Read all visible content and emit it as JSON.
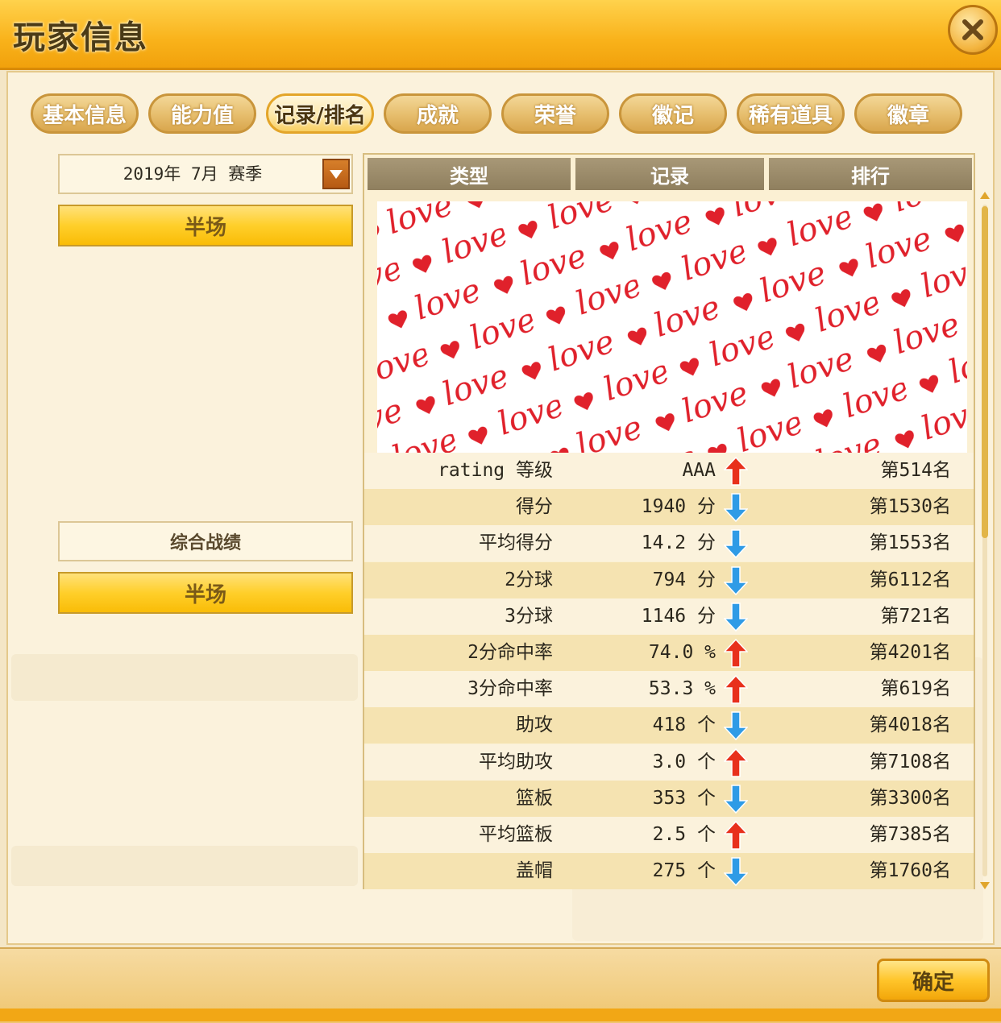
{
  "window": {
    "title": "玩家信息"
  },
  "tabs": [
    {
      "label": "基本信息",
      "active": false
    },
    {
      "label": "能力值",
      "active": false
    },
    {
      "label": "记录/排名",
      "active": true
    },
    {
      "label": "成就",
      "active": false
    },
    {
      "label": "荣誉",
      "active": false
    },
    {
      "label": "徽记",
      "active": false
    },
    {
      "label": "稀有道具",
      "active": false
    },
    {
      "label": "徽章",
      "active": false
    }
  ],
  "left_panel": {
    "season": "2019年 7月 赛季",
    "mode_top": "半场",
    "overall_label": "综合战绩",
    "mode_bottom": "半场"
  },
  "table": {
    "headers": [
      "类型",
      "记录",
      "排行"
    ],
    "banner_text": "love",
    "rows": [
      {
        "type": "rating 等级",
        "value": "AAA",
        "trend": "up",
        "rank": "第514名"
      },
      {
        "type": "得分",
        "value": "1940 分",
        "trend": "down",
        "rank": "第1530名"
      },
      {
        "type": "平均得分",
        "value": "14.2 分",
        "trend": "down",
        "rank": "第1553名"
      },
      {
        "type": "2分球",
        "value": "794 分",
        "trend": "down",
        "rank": "第6112名"
      },
      {
        "type": "3分球",
        "value": "1146 分",
        "trend": "down",
        "rank": "第721名"
      },
      {
        "type": "2分命中率",
        "value": "74.0 %",
        "trend": "up",
        "rank": "第4201名"
      },
      {
        "type": "3分命中率",
        "value": "53.3 %",
        "trend": "up",
        "rank": "第619名"
      },
      {
        "type": "助攻",
        "value": "418 个",
        "trend": "down",
        "rank": "第4018名"
      },
      {
        "type": "平均助攻",
        "value": "3.0 个",
        "trend": "up",
        "rank": "第7108名"
      },
      {
        "type": "篮板",
        "value": "353 个",
        "trend": "down",
        "rank": "第3300名"
      },
      {
        "type": "平均篮板",
        "value": "2.5 个",
        "trend": "up",
        "rank": "第7385名"
      },
      {
        "type": "盖帽",
        "value": "275 个",
        "trend": "down",
        "rank": "第1760名"
      }
    ]
  },
  "footer": {
    "ok_label": "确定"
  },
  "colors": {
    "accent": "#f9b21a",
    "up_arrow": "#e8301c",
    "down_arrow": "#2f9be6",
    "banner_text": "#e0212b"
  }
}
